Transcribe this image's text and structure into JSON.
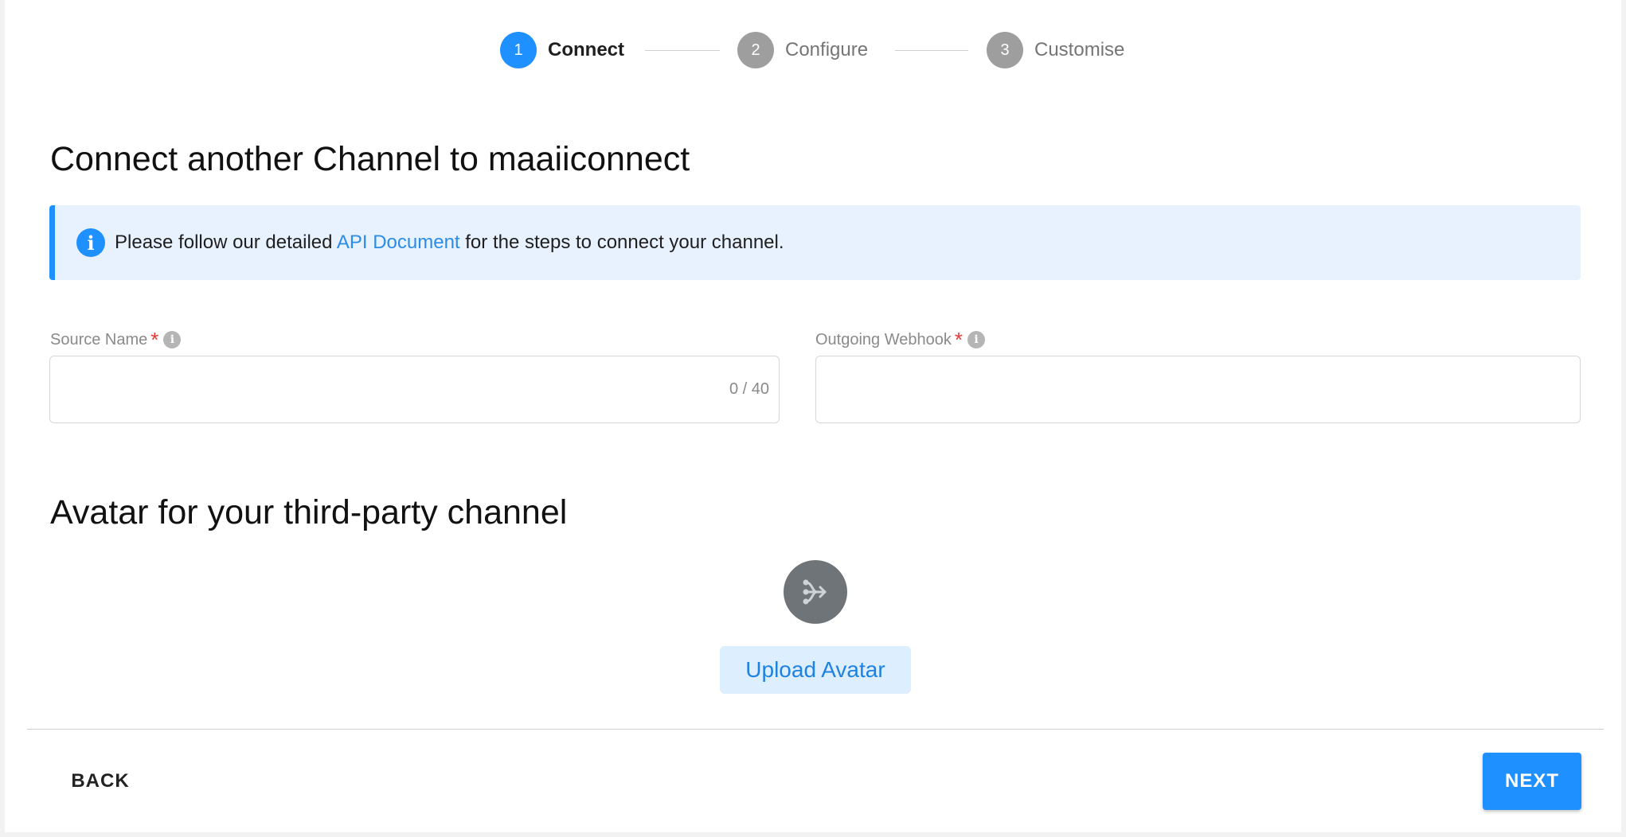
{
  "stepper": {
    "steps": [
      {
        "number": "1",
        "label": "Connect",
        "state": "active"
      },
      {
        "number": "2",
        "label": "Configure",
        "state": "inactive"
      },
      {
        "number": "3",
        "label": "Customise",
        "state": "inactive"
      }
    ]
  },
  "page": {
    "title": "Connect another Channel to maaiiconnect"
  },
  "info_banner": {
    "icon": "info-icon",
    "text_before": "Please follow our detailed",
    "link_text": "API Document",
    "text_after": "for the steps to connect your channel."
  },
  "form": {
    "source_name": {
      "label": "Source Name",
      "required_mark": "*",
      "value": "",
      "counter": "0 / 40"
    },
    "outgoing_webhook": {
      "label": "Outgoing Webhook",
      "required_mark": "*",
      "value": ""
    }
  },
  "avatar_section": {
    "title": "Avatar for your third-party channel",
    "avatar_icon": "fork-arrow-icon",
    "upload_label": "Upload Avatar"
  },
  "footer": {
    "back_label": "BACK",
    "next_label": "NEXT"
  },
  "colors": {
    "accent": "#1e90ff",
    "banner_bg": "#e8f2fe",
    "inactive_step": "#9e9e9e",
    "required": "#e53935",
    "avatar_bg": "#6f7478"
  }
}
